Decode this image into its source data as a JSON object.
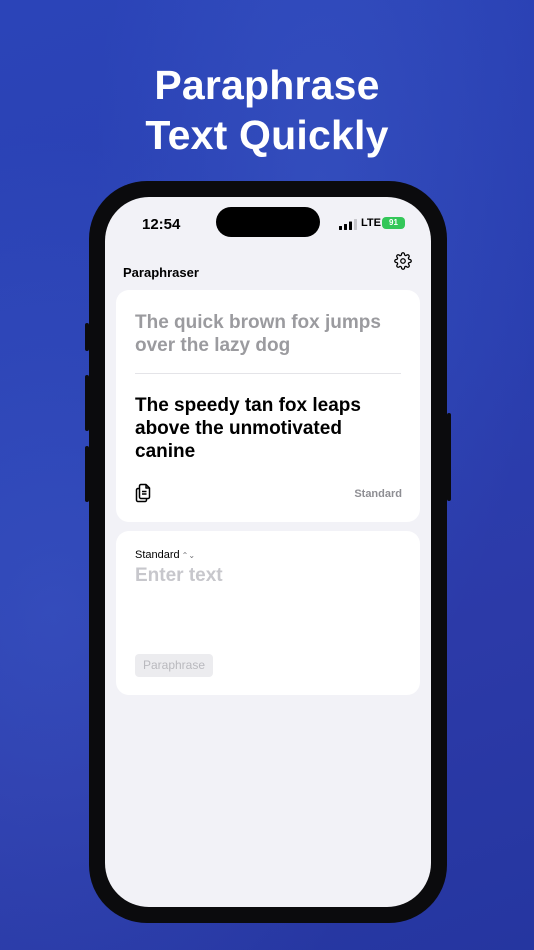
{
  "headline": {
    "line1": "Paraphrase",
    "line2": "Text Quickly"
  },
  "status_bar": {
    "time": "12:54",
    "network": "LTE",
    "battery": "91"
  },
  "nav": {
    "title": "Paraphraser",
    "settings_icon": "gear-icon"
  },
  "output_card": {
    "source_text": "The quick brown fox jumps over the lazy dog",
    "result_text": "The speedy tan fox leaps above the unmotivated canine",
    "copy_icon": "copy-icon",
    "mode": "Standard"
  },
  "input_card": {
    "mode_selector": "Standard",
    "mode_chevron": "⌃⌄",
    "placeholder": "Enter text",
    "value": "",
    "button_label": "Paraphrase"
  },
  "colors": {
    "background": "#2a3fb0",
    "battery": "#34c759",
    "screen": "#f2f2f7"
  }
}
